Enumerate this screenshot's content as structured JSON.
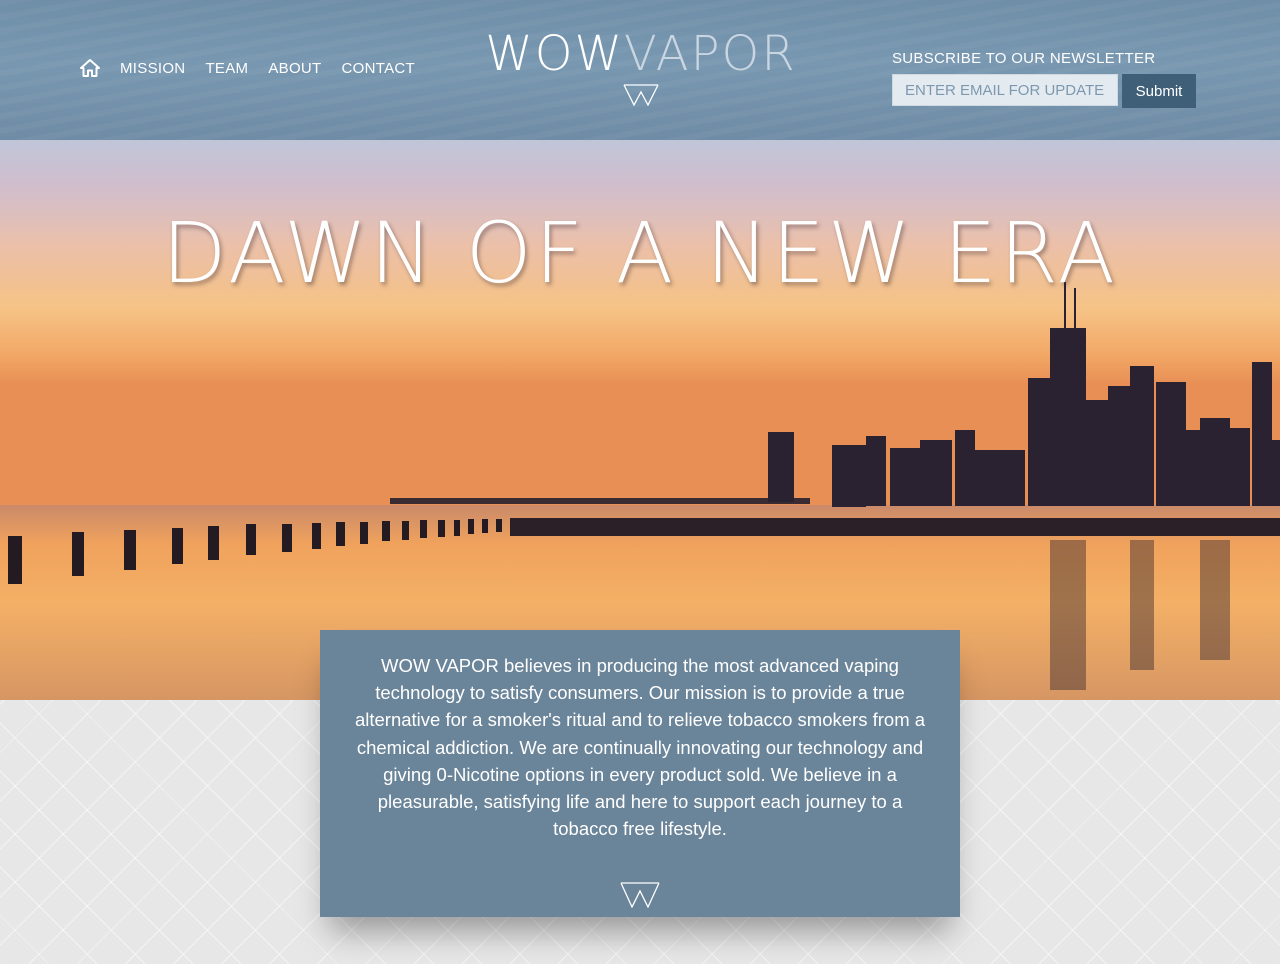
{
  "nav": {
    "home_icon": "home-icon",
    "items": [
      {
        "label": "MISSION"
      },
      {
        "label": "TEAM"
      },
      {
        "label": "ABOUT"
      },
      {
        "label": "CONTACT"
      }
    ]
  },
  "logo": {
    "word1": "WOW",
    "word2": "VAPOR",
    "mark_icon": "w-monogram-icon"
  },
  "newsletter": {
    "title": "SUBSCRIBE TO OUR NEWSLETTER",
    "placeholder": "ENTER EMAIL FOR UPDATES",
    "submit_label": "Submit"
  },
  "hero": {
    "title": "DAWN OF A NEW ERA"
  },
  "mission": {
    "text": "WOW VAPOR believes in producing the most advanced vaping technology to satisfy consumers. Our mission is to provide a true alternative for a smoker's ritual and to relieve tobacco smokers from a chemical addiction. We are continually innovating our technology and giving 0-Nicotine options in every product sold. We believe in a pleasurable, satisfying life and here to support each journey to a tobacco free lifestyle.",
    "mark_icon": "w-monogram-icon"
  },
  "colors": {
    "header_bg": "#7395ae",
    "submit_bg": "#3f5e78",
    "mission_bg": "#6a8499"
  }
}
